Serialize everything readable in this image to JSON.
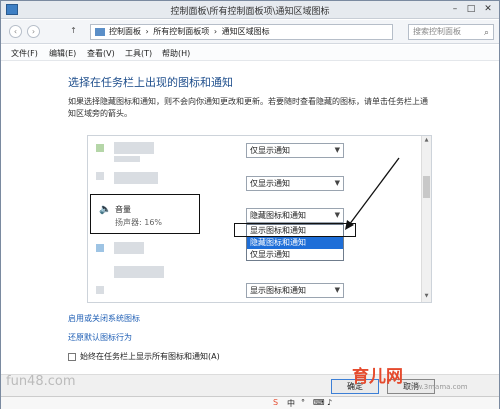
{
  "window": {
    "title": "控制面板\\所有控制面板项\\通知区域图标",
    "min": "–",
    "max": "□",
    "close": "✕"
  },
  "address": {
    "back": "‹",
    "forward": "›",
    "up": "↑",
    "crumbs": [
      "控制面板",
      "›",
      "所有控制面板项",
      "›",
      "通知区域图标"
    ],
    "search_placeholder": "搜索控制面板"
  },
  "menu": [
    "文件(F)",
    "编辑(E)",
    "查看(V)",
    "工具(T)",
    "帮助(H)"
  ],
  "page": {
    "heading": "选择在任务栏上出现的图标和通知",
    "description": "如果选择隐藏图标和通知，则不会向你通知更改和更新。若要随时查看隐藏的图标，请单击任务栏上通知区域旁的箭头。"
  },
  "icons": [
    {
      "behavior": "仅显示通知"
    },
    {
      "behavior": "仅显示通知"
    },
    {
      "name": "音量",
      "detail": "扬声器: 16%",
      "behavior": "隐藏图标和通知"
    },
    {
      "behavior": "显示图标和通知"
    }
  ],
  "dropdown_options": [
    "显示图标和通知",
    "隐藏图标和通知",
    "仅显示通知"
  ],
  "dropdown_highlighted": "隐藏图标和通知",
  "links": {
    "system_icons": "启用或关闭系统图标",
    "restore": "还原默认图标行为"
  },
  "checkbox": {
    "label": "始终在任务栏上显示所有图标和通知(A)",
    "checked": false
  },
  "buttons": {
    "ok": "确定",
    "cancel": "取消"
  },
  "watermarks": {
    "left": "fun48.com",
    "right": "育儿网",
    "right_url": "www.3mama.com"
  },
  "colors": {
    "accent": "#1e6ed8",
    "heading": "#1e4e8c",
    "link": "#1f5fb5"
  }
}
